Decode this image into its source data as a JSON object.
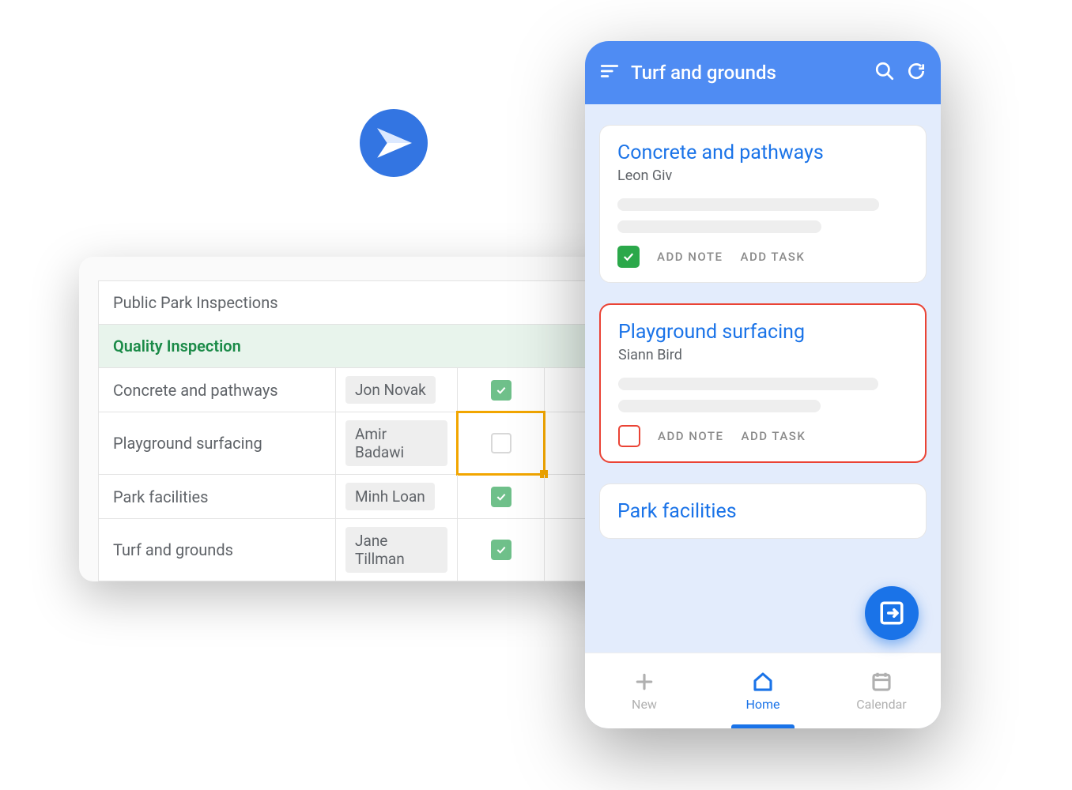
{
  "sheet": {
    "title": "Public Park Inspections",
    "section": "Quality Inspection",
    "rows": [
      {
        "item": "Concrete and pathways",
        "assignee": "Jon Novak",
        "checked": true
      },
      {
        "item": "Playground surfacing",
        "assignee": "Amir Badawi",
        "checked": false
      },
      {
        "item": "Park facilities",
        "assignee": "Minh Loan",
        "checked": true
      },
      {
        "item": "Turf and grounds",
        "assignee": "Jane Tillman",
        "checked": true
      }
    ]
  },
  "phone": {
    "header_title": "Turf and grounds",
    "cards": [
      {
        "title": "Concrete and pathways",
        "subtitle": "Leon Giv",
        "add_note": "ADD NOTE",
        "add_task": "ADD TASK",
        "check_style": "green"
      },
      {
        "title": "Playground surfacing",
        "subtitle": "Siann Bird",
        "add_note": "ADD NOTE",
        "add_task": "ADD TASK",
        "check_style": "red-outline"
      },
      {
        "title": "Park facilities"
      }
    ],
    "nav": {
      "new": "New",
      "home": "Home",
      "calendar": "Calendar"
    }
  }
}
